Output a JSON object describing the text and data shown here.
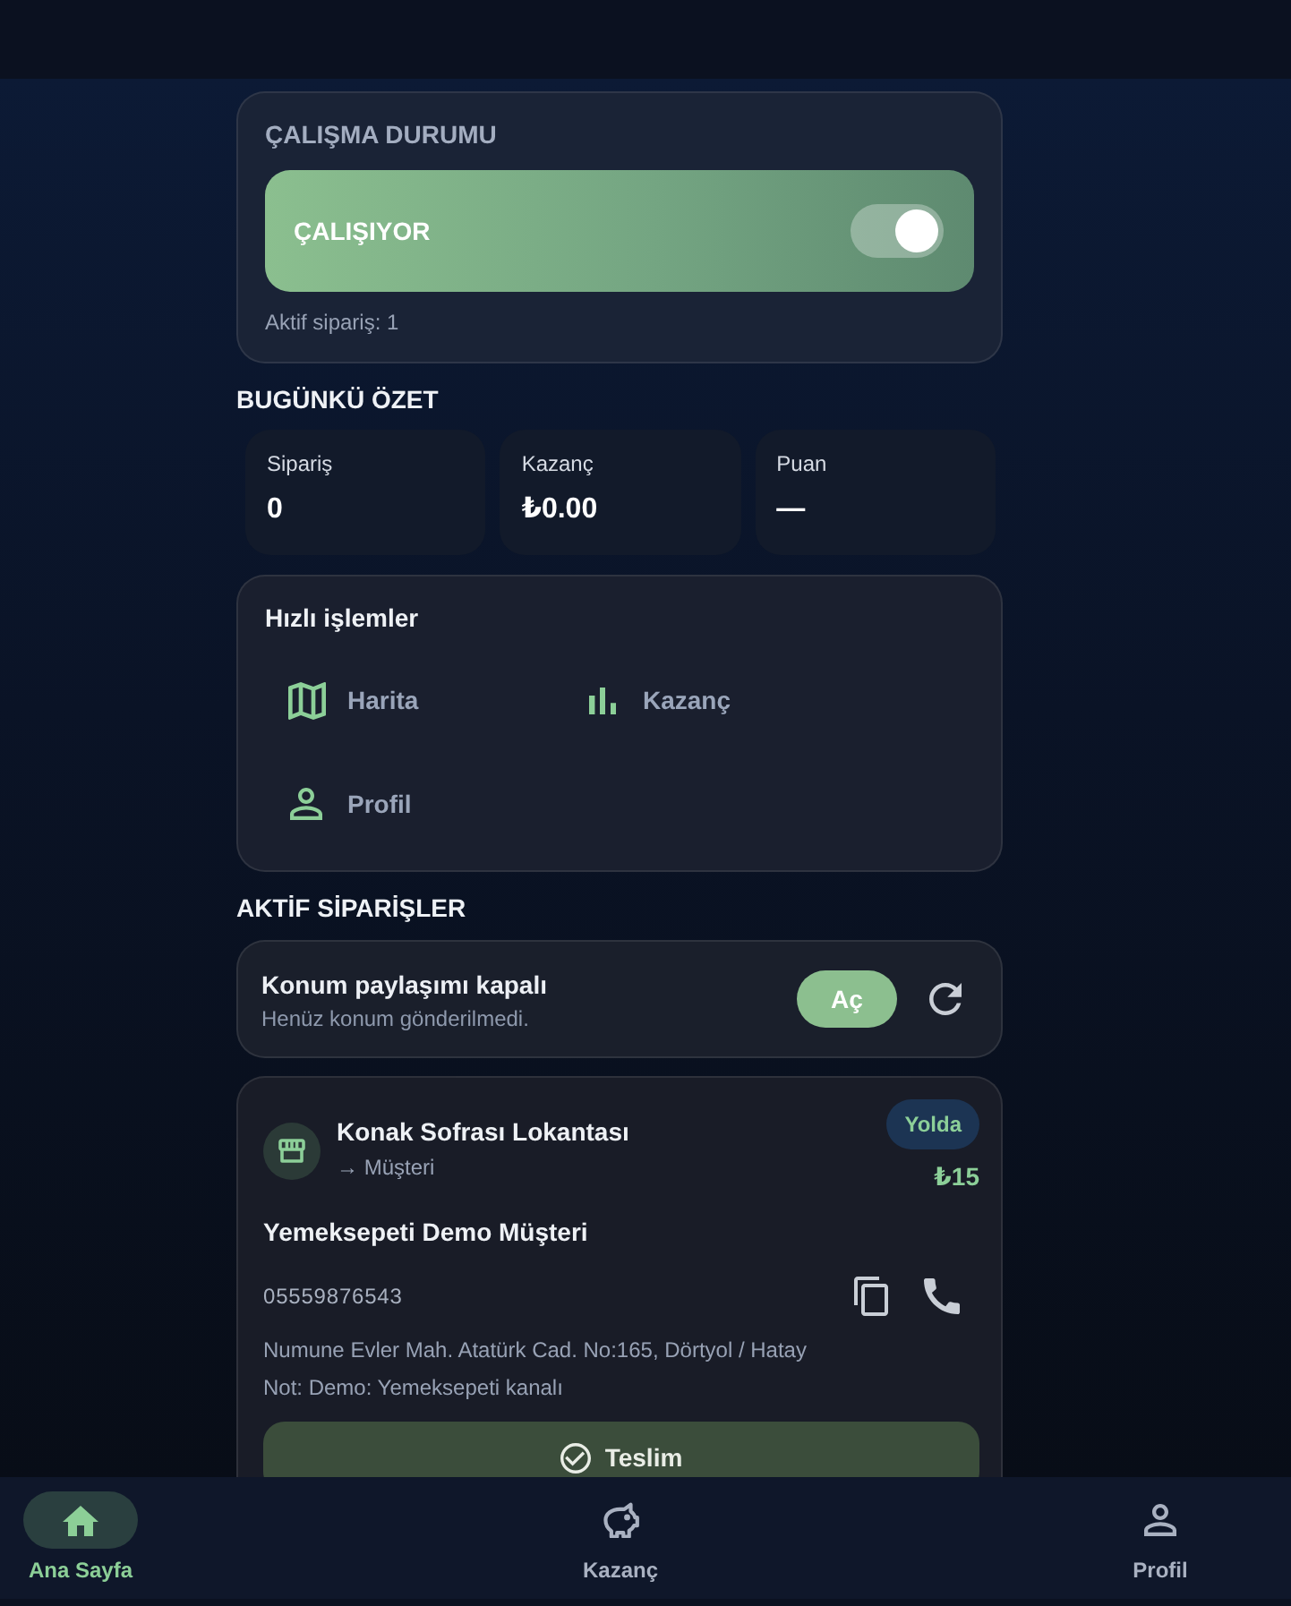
{
  "status_card": {
    "title": "ÇALIŞMA DURUMU",
    "state_label": "ÇALIŞIYOR",
    "on": true,
    "active_orders": "Aktif sipariş: 1"
  },
  "summary": {
    "title": "BUGÜNKÜ ÖZET",
    "stats": [
      {
        "label": "Sipariş",
        "value": "0"
      },
      {
        "label": "Kazanç",
        "value": "₺0.00"
      },
      {
        "label": "Puan",
        "value": "—"
      }
    ]
  },
  "quick_actions": {
    "title": "Hızlı işlemler",
    "items": [
      {
        "kind": "map",
        "label": "Harita"
      },
      {
        "kind": "chart",
        "label": "Kazanç"
      },
      {
        "kind": "person",
        "label": "Profil"
      }
    ]
  },
  "active_orders": {
    "title": "AKTİF SİPARİŞLER",
    "location": {
      "title": "Konum paylaşımı kapalı",
      "subtitle": "Henüz konum gönderilmedi.",
      "button": "Aç"
    },
    "orders": [
      {
        "restaurant": "Konak Sofrası Lokantası",
        "route": "→ Müşteri",
        "status": "Yolda",
        "price": "₺15",
        "customer": "Yemeksepeti Demo Müşteri",
        "phone": "05559876543",
        "address": "Numune Evler Mah. Atatürk Cad. No:165, Dörtyol / Hatay",
        "note": "Not: Demo: Yemeksepeti kanalı",
        "action": "Teslim"
      }
    ]
  },
  "bottom_nav": [
    {
      "kind": "home",
      "label": "Ana Sayfa",
      "selected": true
    },
    {
      "kind": "savings",
      "label": "Kazanç",
      "selected": false
    },
    {
      "kind": "person",
      "label": "Profil",
      "selected": false
    }
  ]
}
